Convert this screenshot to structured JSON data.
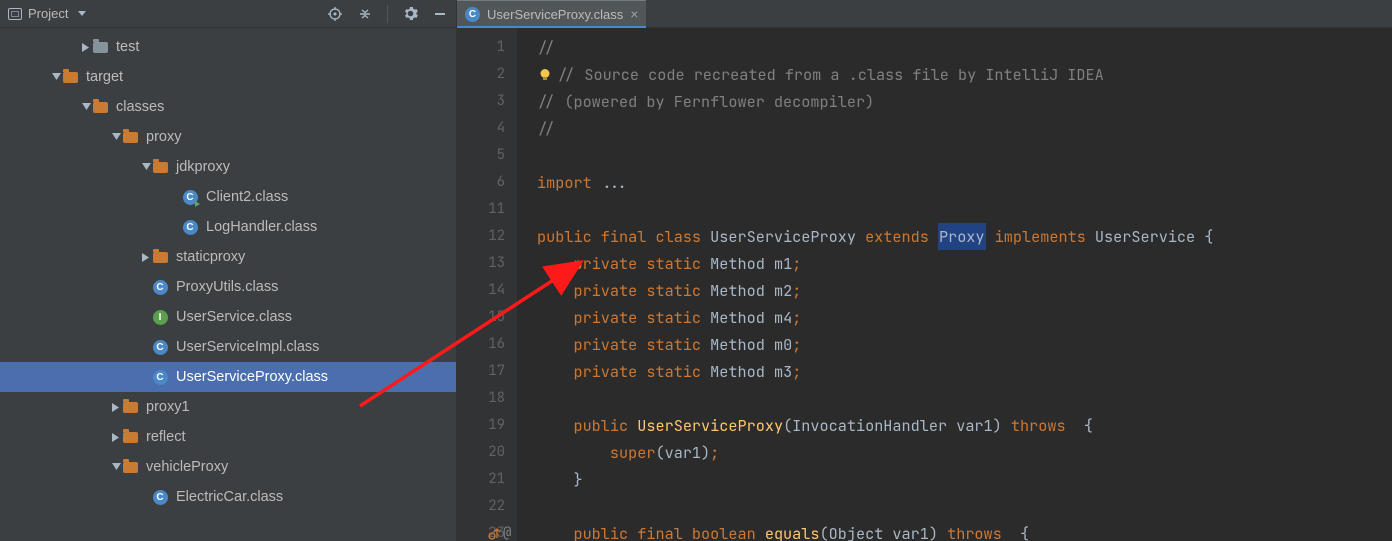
{
  "header": {
    "title": "Project"
  },
  "tree": {
    "items": [
      {
        "label": "test",
        "depth": 2,
        "arrow": "right",
        "icon": "folder-gray"
      },
      {
        "label": "target",
        "depth": 1,
        "arrow": "down",
        "icon": "folder-orange"
      },
      {
        "label": "classes",
        "depth": 2,
        "arrow": "down",
        "icon": "folder-orange"
      },
      {
        "label": "proxy",
        "depth": 3,
        "arrow": "down",
        "icon": "folder-orange"
      },
      {
        "label": "jdkproxy",
        "depth": 4,
        "arrow": "down",
        "icon": "folder-orange"
      },
      {
        "label": "Client2.class",
        "depth": 5,
        "arrow": "none",
        "icon": "class-c-run"
      },
      {
        "label": "LogHandler.class",
        "depth": 5,
        "arrow": "none",
        "icon": "class-c"
      },
      {
        "label": "staticproxy",
        "depth": 4,
        "arrow": "right",
        "icon": "folder-orange"
      },
      {
        "label": "ProxyUtils.class",
        "depth": 4,
        "arrow": "none",
        "icon": "class-c"
      },
      {
        "label": "UserService.class",
        "depth": 4,
        "arrow": "none",
        "icon": "class-i"
      },
      {
        "label": "UserServiceImpl.class",
        "depth": 4,
        "arrow": "none",
        "icon": "class-c"
      },
      {
        "label": "UserServiceProxy.class",
        "depth": 4,
        "arrow": "none",
        "icon": "class-c",
        "selected": true
      },
      {
        "label": "proxy1",
        "depth": 3,
        "arrow": "right",
        "icon": "folder-orange"
      },
      {
        "label": "reflect",
        "depth": 3,
        "arrow": "right",
        "icon": "folder-orange"
      },
      {
        "label": "vehicleProxy",
        "depth": 3,
        "arrow": "down",
        "icon": "folder-orange"
      },
      {
        "label": "ElectricCar.class",
        "depth": 4,
        "arrow": "none",
        "icon": "class-c"
      }
    ]
  },
  "tab": {
    "title": "UserServiceProxy.class"
  },
  "code": {
    "lines": [
      {
        "n": "1",
        "tokens": [
          {
            "t": "//",
            "c": "cmt"
          }
        ]
      },
      {
        "n": "2",
        "bulb": true,
        "tokens": [
          {
            "t": "// ",
            "c": "cmt"
          },
          {
            "t": "Source code recreated from a .class file by IntelliJ IDEA",
            "c": "cmt"
          }
        ]
      },
      {
        "n": "3",
        "tokens": [
          {
            "t": "// (powered by Fernflower decompiler)",
            "c": "cmt"
          }
        ]
      },
      {
        "n": "4",
        "tokens": [
          {
            "t": "//",
            "c": "cmt"
          }
        ]
      },
      {
        "n": "5",
        "tokens": []
      },
      {
        "n": "6",
        "tokens": [
          {
            "t": "import ",
            "c": "kw"
          },
          {
            "t": "...",
            "c": "ident"
          }
        ]
      },
      {
        "n": "11",
        "tokens": []
      },
      {
        "n": "12",
        "tokens": [
          {
            "t": "public final class ",
            "c": "kw"
          },
          {
            "t": "UserServiceProxy ",
            "c": "classname"
          },
          {
            "t": "extends ",
            "c": "kw"
          },
          {
            "t": "Proxy",
            "c": "hl"
          },
          {
            "t": " ",
            "c": "ident"
          },
          {
            "t": "implements ",
            "c": "kw"
          },
          {
            "t": "UserService {",
            "c": "ident"
          }
        ]
      },
      {
        "n": "13",
        "indent": 1,
        "tokens": [
          {
            "t": "private static ",
            "c": "kw"
          },
          {
            "t": "Method ",
            "c": "ident"
          },
          {
            "t": "m1",
            "c": "ident"
          },
          {
            "t": ";",
            "c": "kw"
          }
        ]
      },
      {
        "n": "14",
        "indent": 1,
        "tokens": [
          {
            "t": "private static ",
            "c": "kw"
          },
          {
            "t": "Method ",
            "c": "ident"
          },
          {
            "t": "m2",
            "c": "ident"
          },
          {
            "t": ";",
            "c": "kw"
          }
        ]
      },
      {
        "n": "15",
        "indent": 1,
        "tokens": [
          {
            "t": "private static ",
            "c": "kw"
          },
          {
            "t": "Method ",
            "c": "ident"
          },
          {
            "t": "m4",
            "c": "ident"
          },
          {
            "t": ";",
            "c": "kw"
          }
        ]
      },
      {
        "n": "16",
        "indent": 1,
        "tokens": [
          {
            "t": "private static ",
            "c": "kw"
          },
          {
            "t": "Method ",
            "c": "ident"
          },
          {
            "t": "m0",
            "c": "ident"
          },
          {
            "t": ";",
            "c": "kw"
          }
        ]
      },
      {
        "n": "17",
        "indent": 1,
        "tokens": [
          {
            "t": "private static ",
            "c": "kw"
          },
          {
            "t": "Method ",
            "c": "ident"
          },
          {
            "t": "m3",
            "c": "ident"
          },
          {
            "t": ";",
            "c": "kw"
          }
        ]
      },
      {
        "n": "18",
        "tokens": []
      },
      {
        "n": "19",
        "indent": 1,
        "tokens": [
          {
            "t": "public ",
            "c": "kw"
          },
          {
            "t": "UserServiceProxy",
            "c": "decl"
          },
          {
            "t": "(InvocationHandler var1) ",
            "c": "ident"
          },
          {
            "t": "throws ",
            "c": "kw"
          },
          {
            "t": " {",
            "c": "ident"
          }
        ]
      },
      {
        "n": "20",
        "indent": 2,
        "tokens": [
          {
            "t": "super",
            "c": "kw"
          },
          {
            "t": "(var1)",
            "c": "ident"
          },
          {
            "t": ";",
            "c": "kw"
          }
        ]
      },
      {
        "n": "21",
        "indent": 1,
        "tokens": [
          {
            "t": "}",
            "c": "ident"
          }
        ]
      },
      {
        "n": "22",
        "tokens": []
      },
      {
        "n": "23",
        "override": true,
        "indent": 1,
        "tokens": [
          {
            "t": "public final boolean ",
            "c": "kw"
          },
          {
            "t": "equals",
            "c": "decl"
          },
          {
            "t": "(Object var1) ",
            "c": "ident"
          },
          {
            "t": "throws ",
            "c": "kw"
          },
          {
            "t": " {",
            "c": "ident"
          }
        ]
      }
    ]
  }
}
